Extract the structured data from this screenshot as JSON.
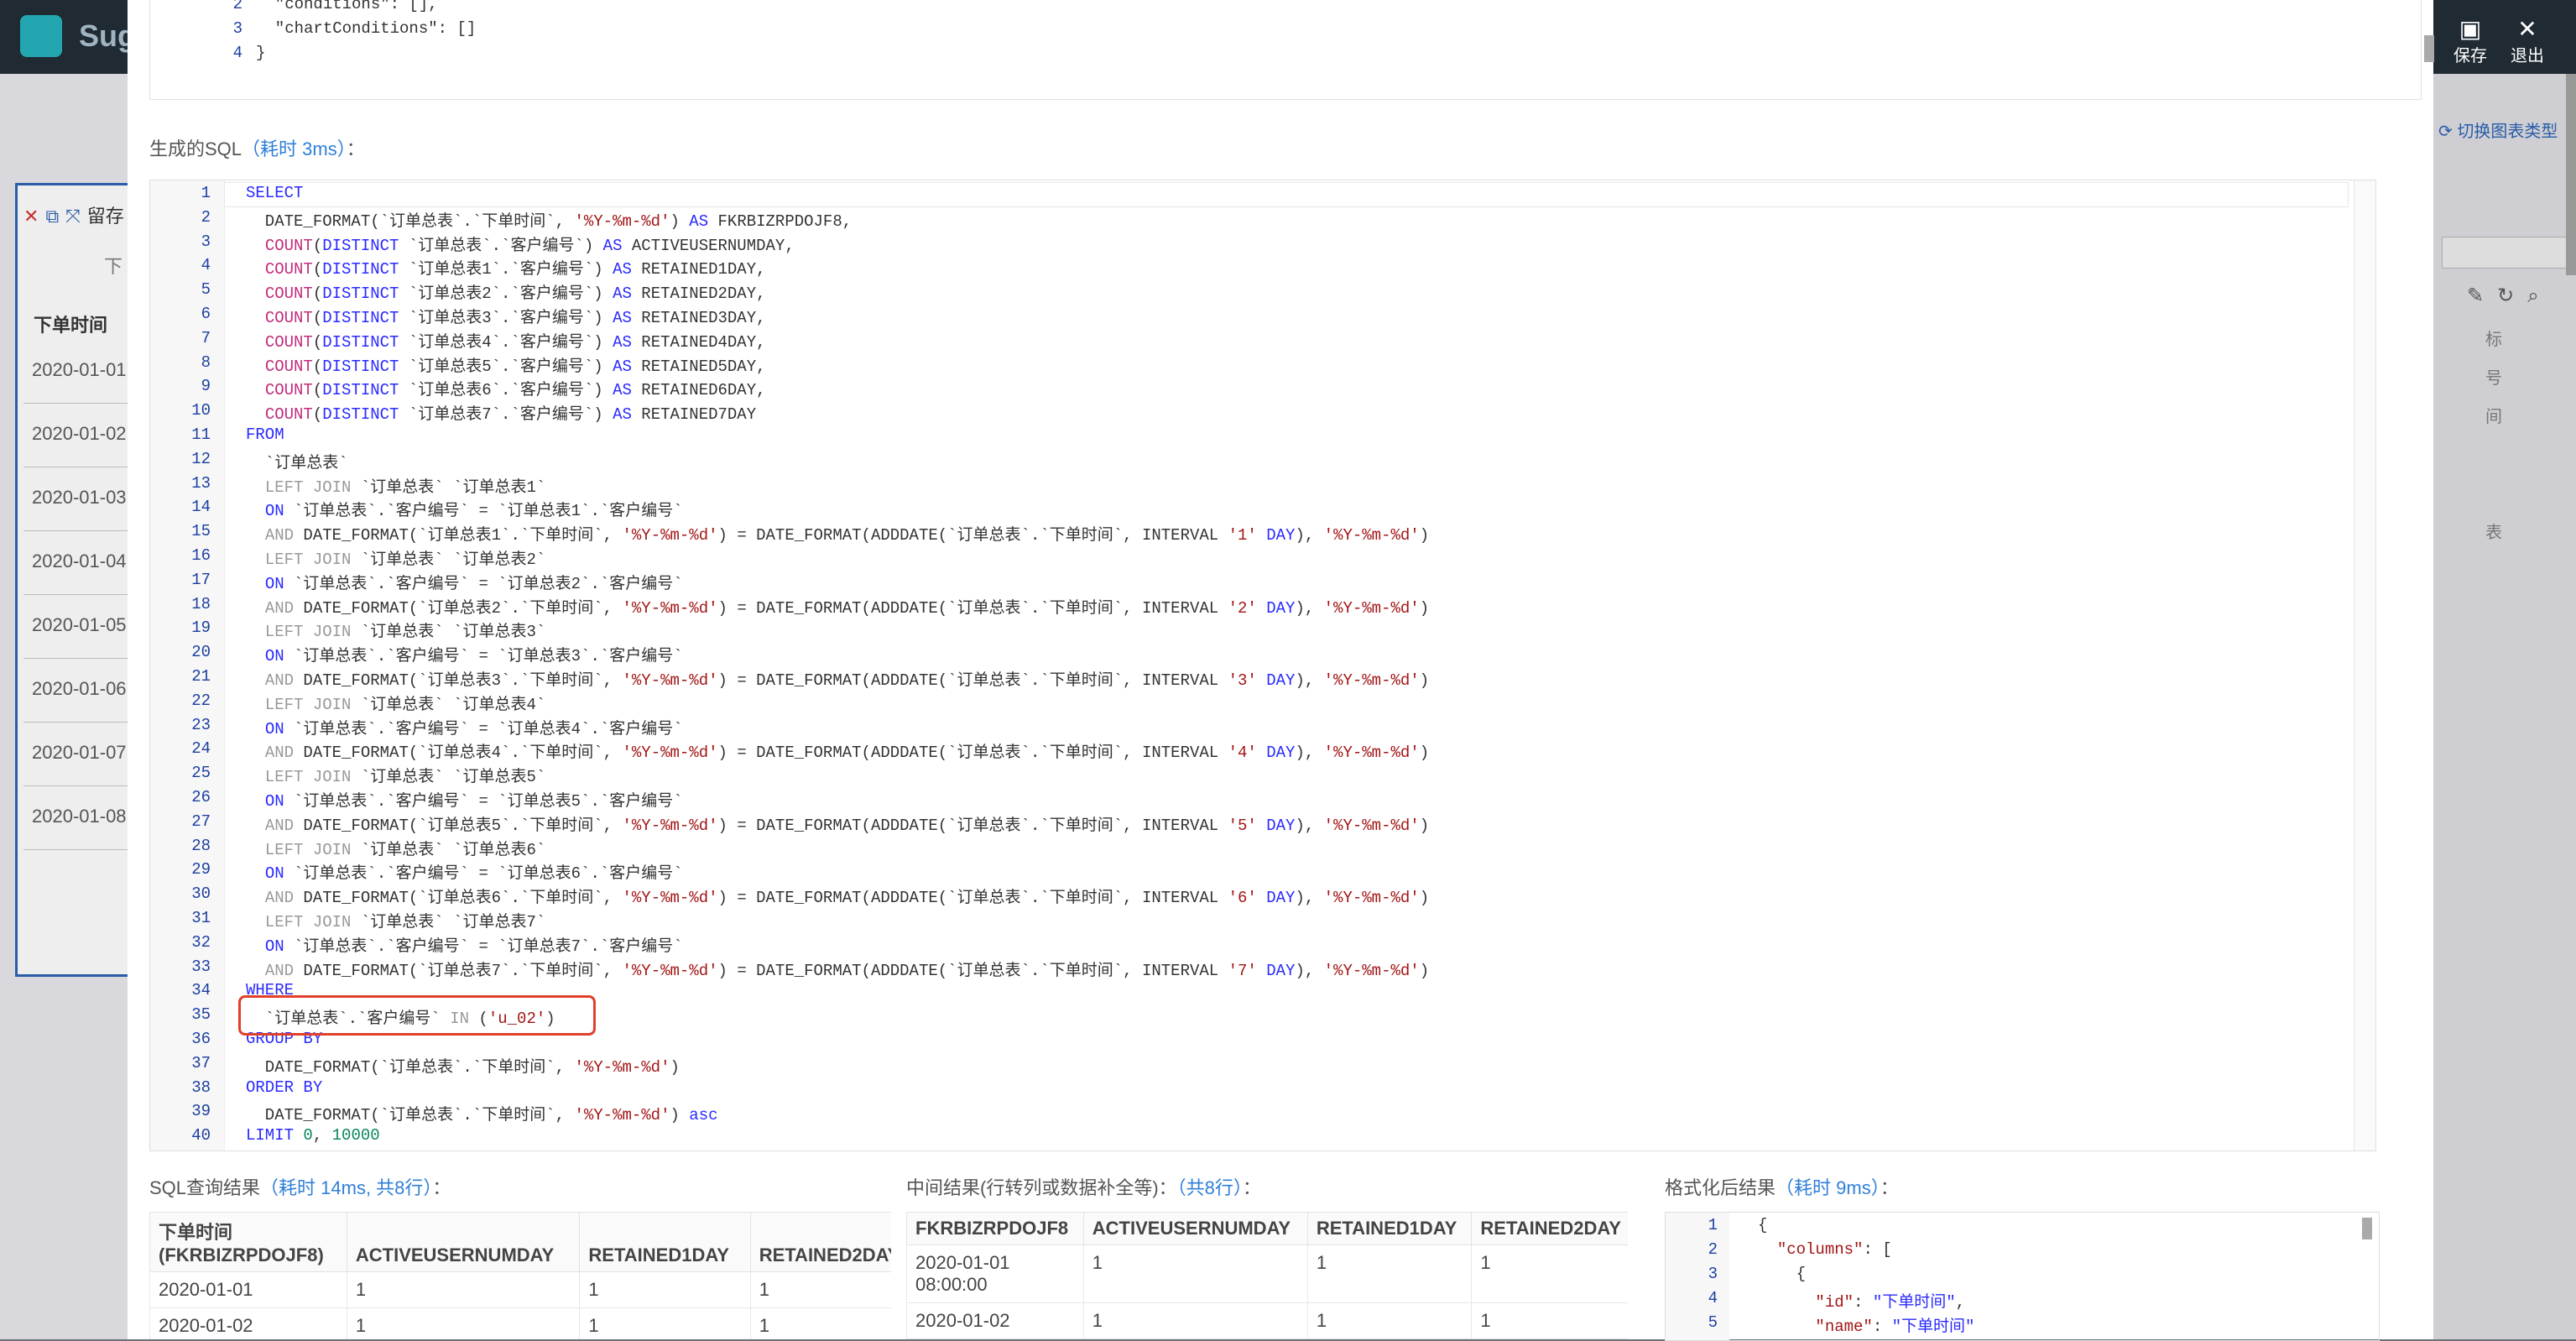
{
  "app": {
    "brand": "Sug",
    "save": "保存",
    "exit": "退出",
    "switch_chart": "切换图表类型"
  },
  "bg_panel": {
    "header": "下单时间",
    "sub": "下",
    "title": "留存",
    "rows": [
      "2020-01-01",
      "2020-01-02",
      "2020-01-03",
      "2020-01-04",
      "2020-01-05",
      "2020-01-06",
      "2020-01-07",
      "2020-01-08"
    ],
    "right_chars": [
      "标",
      "号",
      "间",
      "表"
    ]
  },
  "top_json": {
    "lines": [
      {
        "n": "2",
        "text": "  \"conditions\": [],"
      },
      {
        "n": "3",
        "text": "  \"chartConditions\": []"
      },
      {
        "n": "4",
        "text": "}"
      }
    ]
  },
  "sql_section": {
    "label": "生成的SQL",
    "timing": "（耗时 3ms）",
    "colon": "："
  },
  "sql_lines": [
    {
      "n": "1",
      "html": "<span class='kw'>SELECT</span>"
    },
    {
      "n": "2",
      "html": "  DATE_FORMAT(`订单总表`.`下单时间`, <span class='str'>'%Y-%m-%d'</span>) <span class='kw'>AS</span> FKRBIZRPDOJF8,"
    },
    {
      "n": "3",
      "html": "  <span class='fn'>COUNT</span>(<span class='kw'>DISTINCT</span> `订单总表`.`客户编号`) <span class='kw'>AS</span> ACTIVEUSERNUMDAY,"
    },
    {
      "n": "4",
      "html": "  <span class='fn'>COUNT</span>(<span class='kw'>DISTINCT</span> `订单总表1`.`客户编号`) <span class='kw'>AS</span> RETAINED1DAY,"
    },
    {
      "n": "5",
      "html": "  <span class='fn'>COUNT</span>(<span class='kw'>DISTINCT</span> `订单总表2`.`客户编号`) <span class='kw'>AS</span> RETAINED2DAY,"
    },
    {
      "n": "6",
      "html": "  <span class='fn'>COUNT</span>(<span class='kw'>DISTINCT</span> `订单总表3`.`客户编号`) <span class='kw'>AS</span> RETAINED3DAY,"
    },
    {
      "n": "7",
      "html": "  <span class='fn'>COUNT</span>(<span class='kw'>DISTINCT</span> `订单总表4`.`客户编号`) <span class='kw'>AS</span> RETAINED4DAY,"
    },
    {
      "n": "8",
      "html": "  <span class='fn'>COUNT</span>(<span class='kw'>DISTINCT</span> `订单总表5`.`客户编号`) <span class='kw'>AS</span> RETAINED5DAY,"
    },
    {
      "n": "9",
      "html": "  <span class='fn'>COUNT</span>(<span class='kw'>DISTINCT</span> `订单总表6`.`客户编号`) <span class='kw'>AS</span> RETAINED6DAY,"
    },
    {
      "n": "10",
      "html": "  <span class='fn'>COUNT</span>(<span class='kw'>DISTINCT</span> `订单总表7`.`客户编号`) <span class='kw'>AS</span> RETAINED7DAY"
    },
    {
      "n": "11",
      "html": "<span class='kw'>FROM</span>"
    },
    {
      "n": "12",
      "html": "  `订单总表`"
    },
    {
      "n": "13",
      "html": "  <span class='mute'>LEFT JOIN</span> `订单总表` `订单总表1`"
    },
    {
      "n": "14",
      "html": "  <span class='kw'>ON</span> `订单总表`.`客户编号` = `订单总表1`.`客户编号`"
    },
    {
      "n": "15",
      "html": "  <span class='mute'>AND</span> DATE_FORMAT(`订单总表1`.`下单时间`, <span class='str'>'%Y-%m-%d'</span>) = DATE_FORMAT(ADDDATE(`订单总表`.`下单时间`, INTERVAL <span class='str'>'1'</span> <span class='kw'>DAY</span>), <span class='str'>'%Y-%m-%d'</span>)"
    },
    {
      "n": "16",
      "html": "  <span class='mute'>LEFT JOIN</span> `订单总表` `订单总表2`"
    },
    {
      "n": "17",
      "html": "  <span class='kw'>ON</span> `订单总表`.`客户编号` = `订单总表2`.`客户编号`"
    },
    {
      "n": "18",
      "html": "  <span class='mute'>AND</span> DATE_FORMAT(`订单总表2`.`下单时间`, <span class='str'>'%Y-%m-%d'</span>) = DATE_FORMAT(ADDDATE(`订单总表`.`下单时间`, INTERVAL <span class='str'>'2'</span> <span class='kw'>DAY</span>), <span class='str'>'%Y-%m-%d'</span>)"
    },
    {
      "n": "19",
      "html": "  <span class='mute'>LEFT JOIN</span> `订单总表` `订单总表3`"
    },
    {
      "n": "20",
      "html": "  <span class='kw'>ON</span> `订单总表`.`客户编号` = `订单总表3`.`客户编号`"
    },
    {
      "n": "21",
      "html": "  <span class='mute'>AND</span> DATE_FORMAT(`订单总表3`.`下单时间`, <span class='str'>'%Y-%m-%d'</span>) = DATE_FORMAT(ADDDATE(`订单总表`.`下单时间`, INTERVAL <span class='str'>'3'</span> <span class='kw'>DAY</span>), <span class='str'>'%Y-%m-%d'</span>)"
    },
    {
      "n": "22",
      "html": "  <span class='mute'>LEFT JOIN</span> `订单总表` `订单总表4`"
    },
    {
      "n": "23",
      "html": "  <span class='kw'>ON</span> `订单总表`.`客户编号` = `订单总表4`.`客户编号`"
    },
    {
      "n": "24",
      "html": "  <span class='mute'>AND</span> DATE_FORMAT(`订单总表4`.`下单时间`, <span class='str'>'%Y-%m-%d'</span>) = DATE_FORMAT(ADDDATE(`订单总表`.`下单时间`, INTERVAL <span class='str'>'4'</span> <span class='kw'>DAY</span>), <span class='str'>'%Y-%m-%d'</span>)"
    },
    {
      "n": "25",
      "html": "  <span class='mute'>LEFT JOIN</span> `订单总表` `订单总表5`"
    },
    {
      "n": "26",
      "html": "  <span class='kw'>ON</span> `订单总表`.`客户编号` = `订单总表5`.`客户编号`"
    },
    {
      "n": "27",
      "html": "  <span class='mute'>AND</span> DATE_FORMAT(`订单总表5`.`下单时间`, <span class='str'>'%Y-%m-%d'</span>) = DATE_FORMAT(ADDDATE(`订单总表`.`下单时间`, INTERVAL <span class='str'>'5'</span> <span class='kw'>DAY</span>), <span class='str'>'%Y-%m-%d'</span>)"
    },
    {
      "n": "28",
      "html": "  <span class='mute'>LEFT JOIN</span> `订单总表` `订单总表6`"
    },
    {
      "n": "29",
      "html": "  <span class='kw'>ON</span> `订单总表`.`客户编号` = `订单总表6`.`客户编号`"
    },
    {
      "n": "30",
      "html": "  <span class='mute'>AND</span> DATE_FORMAT(`订单总表6`.`下单时间`, <span class='str'>'%Y-%m-%d'</span>) = DATE_FORMAT(ADDDATE(`订单总表`.`下单时间`, INTERVAL <span class='str'>'6'</span> <span class='kw'>DAY</span>), <span class='str'>'%Y-%m-%d'</span>)"
    },
    {
      "n": "31",
      "html": "  <span class='mute'>LEFT JOIN</span> `订单总表` `订单总表7`"
    },
    {
      "n": "32",
      "html": "  <span class='kw'>ON</span> `订单总表`.`客户编号` = `订单总表7`.`客户编号`"
    },
    {
      "n": "33",
      "html": "  <span class='mute'>AND</span> DATE_FORMAT(`订单总表7`.`下单时间`, <span class='str'>'%Y-%m-%d'</span>) = DATE_FORMAT(ADDDATE(`订单总表`.`下单时间`, INTERVAL <span class='str'>'7'</span> <span class='kw'>DAY</span>), <span class='str'>'%Y-%m-%d'</span>)"
    },
    {
      "n": "34",
      "html": "<span class='kw'>WHERE</span>"
    },
    {
      "n": "35",
      "html": "  `订单总表`.`客户编号` <span class='mute'>IN</span> (<span class='str'>'u_02'</span>)"
    },
    {
      "n": "36",
      "html": "<span class='kw'>GROUP BY</span>"
    },
    {
      "n": "37",
      "html": "  DATE_FORMAT(`订单总表`.`下单时间`, <span class='str'>'%Y-%m-%d'</span>)"
    },
    {
      "n": "38",
      "html": "<span class='kw'>ORDER BY</span>"
    },
    {
      "n": "39",
      "html": "  DATE_FORMAT(`订单总表`.`下单时间`, <span class='str'>'%Y-%m-%d'</span>) <span class='kw'>asc</span>"
    },
    {
      "n": "40",
      "html": "<span class='kw'>LIMIT</span> <span class='num'>0</span>, <span class='num'>10000</span>"
    }
  ],
  "sql_result": {
    "label": "SQL查询结果",
    "timing": "（耗时 14ms, 共8行）",
    "colon": "：",
    "headers": [
      "下单时间\n(FKRBIZRPDOJF8)",
      "ACTIVEUSERNUMDAY",
      "RETAINED1DAY",
      "RETAINED2DAY"
    ],
    "rows": [
      [
        "2020-01-01",
        "1",
        "1",
        "1"
      ],
      [
        "2020-01-02",
        "1",
        "1",
        "1"
      ]
    ]
  },
  "middle_result": {
    "label": "中间结果(行转列或数据补全等)",
    "colon1": "：",
    "count": "（共8行）",
    "colon": "：",
    "headers": [
      "FKRBIZRPDOJF8",
      "ACTIVEUSERNUMDAY",
      "RETAINED1DAY",
      "RETAINED2DAY"
    ],
    "rows": [
      [
        "2020-01-01\n08:00:00",
        "1",
        "1",
        "1"
      ],
      [
        "2020-01-02",
        "1",
        "1",
        "1"
      ]
    ]
  },
  "formatted_result": {
    "label": "格式化后结果",
    "timing": "（耗时 9ms）",
    "colon": "：",
    "lines": [
      {
        "n": "1",
        "html": "{"
      },
      {
        "n": "2",
        "html": "  <span class='str'>\"columns\"</span>: ["
      },
      {
        "n": "3",
        "html": "    {"
      },
      {
        "n": "4",
        "html": "      <span class='str'>\"id\"</span>: <span class='kw'>\"下单时间\"</span>,"
      },
      {
        "n": "5",
        "html": "      <span class='str'>\"name\"</span>: <span class='kw'>\"下单时间\"</span>"
      }
    ]
  }
}
